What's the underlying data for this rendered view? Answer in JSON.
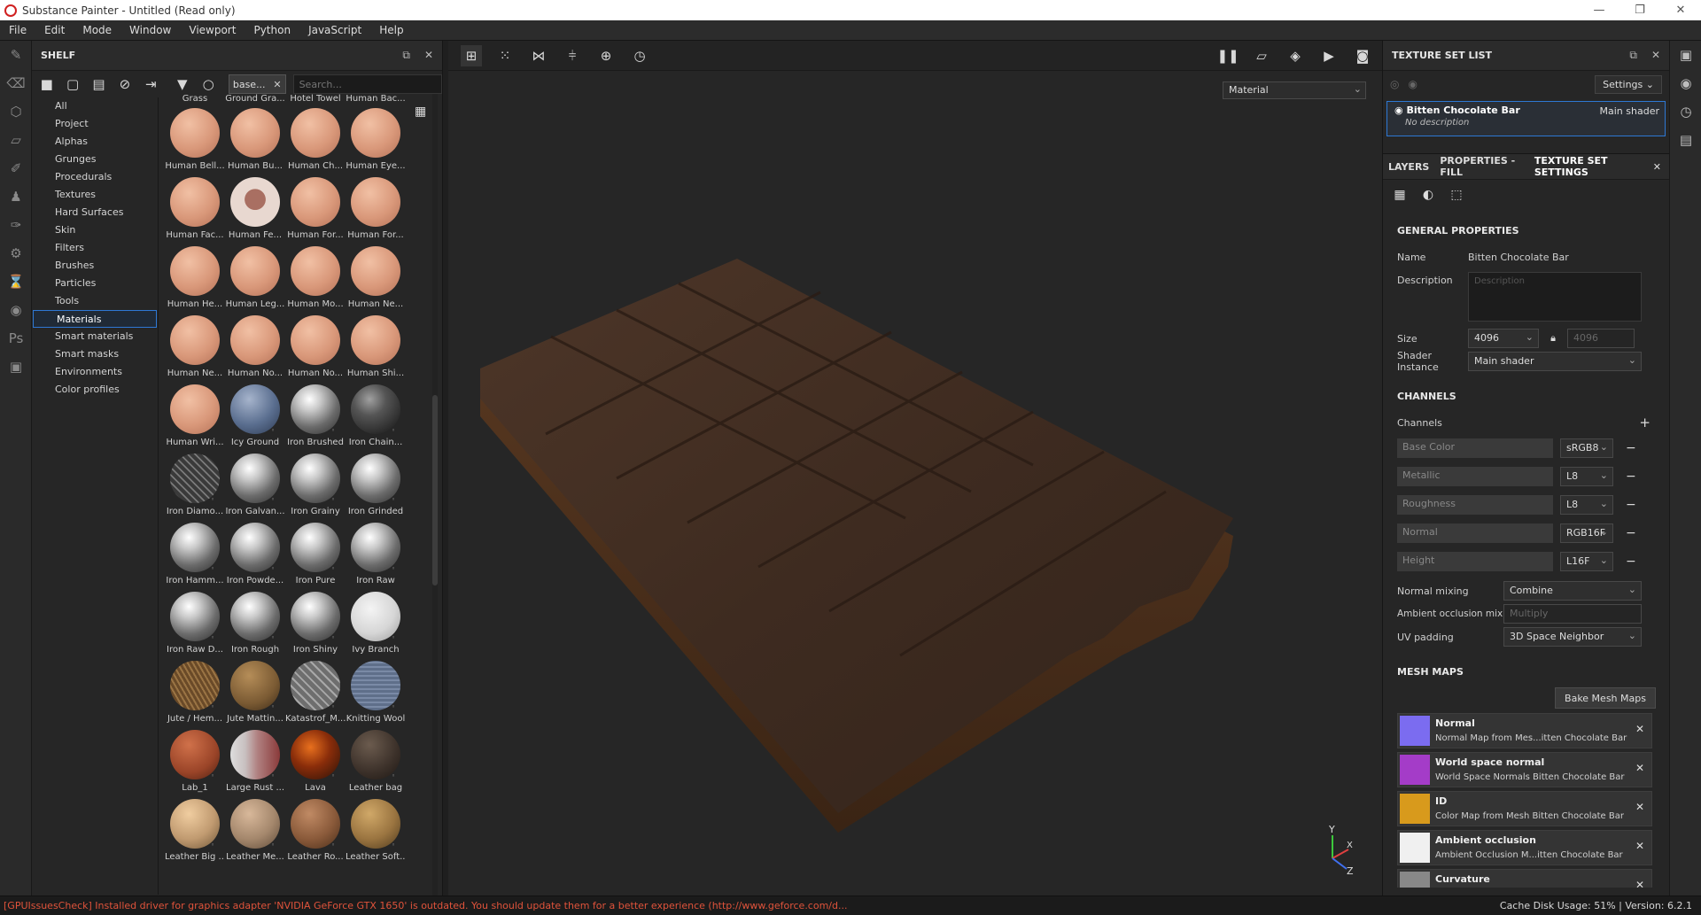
{
  "titlebar": {
    "title": "Substance Painter - Untitled (Read only)"
  },
  "menu": [
    "File",
    "Edit",
    "Mode",
    "Window",
    "Viewport",
    "Python",
    "JavaScript",
    "Help"
  ],
  "shelf": {
    "title": "SHELF",
    "filter_chip": "base...",
    "search_placeholder": "Search...",
    "categories": [
      "All",
      "Project",
      "Alphas",
      "Grunges",
      "Procedurals",
      "Textures",
      "Hard Surfaces",
      "Skin",
      "Filters",
      "Brushes",
      "Particles",
      "Tools",
      "Materials",
      "Smart materials",
      "Smart masks",
      "Environments",
      "Color profiles"
    ],
    "active_category": "Materials",
    "top_labels": [
      "Grass",
      "Ground Gra...",
      "Hotel Towel",
      "Human Bac..."
    ],
    "materials": [
      "Human Bell...",
      "Human Bu...",
      "Human Ch...",
      "Human Eye...",
      "Human Fac...",
      "Human Fe...",
      "Human For...",
      "Human For...",
      "Human He...",
      "Human Leg...",
      "Human Mo...",
      "Human Ne...",
      "Human Ne...",
      "Human No...",
      "Human No...",
      "Human Shi...",
      "Human Wri...",
      "Icy Ground",
      "Iron Brushed",
      "Iron Chain...",
      "Iron Diamo...",
      "Iron Galvan...",
      "Iron Grainy",
      "Iron Grinded",
      "Iron Hamm...",
      "Iron Powde...",
      "Iron Pure",
      "Iron Raw",
      "Iron Raw D...",
      "Iron Rough",
      "Iron Shiny",
      "Ivy Branch",
      "Jute / Hem...",
      "Jute Mattin...",
      "Katastrof_M...",
      "Knitting Wool",
      "Lab_1",
      "Large Rust ...",
      "Lava",
      "Leather bag",
      "Leather Big ...",
      "Leather Me...",
      "Leather Ro...",
      "Leather Soft..."
    ]
  },
  "viewport": {
    "material_select": "Material",
    "gizmo": {
      "y": "Y",
      "x": "X",
      "z": "Z"
    }
  },
  "texture_set_list": {
    "title": "TEXTURE SET LIST",
    "settings_label": "Settings",
    "item": {
      "name": "Bitten Chocolate Bar",
      "shader": "Main shader",
      "description": "No description"
    }
  },
  "tabs": {
    "layers": "LAYERS",
    "properties": "PROPERTIES - FILL",
    "tss": "TEXTURE SET SETTINGS"
  },
  "general": {
    "title": "GENERAL PROPERTIES",
    "name_label": "Name",
    "name_value": "Bitten Chocolate Bar",
    "description_label": "Description",
    "description_placeholder": "Description",
    "size_label": "Size",
    "size_value": "4096",
    "size_value2": "4096",
    "shader_label": "Shader Instance",
    "shader_value": "Main shader"
  },
  "channels": {
    "title": "CHANNELS",
    "label": "Channels",
    "list": [
      {
        "name": "Base Color",
        "format": "sRGB8"
      },
      {
        "name": "Metallic",
        "format": "L8"
      },
      {
        "name": "Roughness",
        "format": "L8"
      },
      {
        "name": "Normal",
        "format": "RGB16F"
      },
      {
        "name": "Height",
        "format": "L16F"
      }
    ],
    "normal_mixing_label": "Normal mixing",
    "normal_mixing_value": "Combine",
    "ao_mixing_label": "Ambient occlusion mixing",
    "ao_mixing_value": "Multiply",
    "uv_padding_label": "UV padding",
    "uv_padding_value": "3D Space Neighbor"
  },
  "mesh_maps": {
    "title": "MESH MAPS",
    "bake_label": "Bake Mesh Maps",
    "list": [
      {
        "name": "Normal",
        "desc": "Normal Map from Mes...itten Chocolate Bar",
        "color": "#7b6cf0"
      },
      {
        "name": "World space normal",
        "desc": "World Space Normals Bitten Chocolate Bar",
        "color": "#a43cc8"
      },
      {
        "name": "ID",
        "desc": "Color Map from Mesh Bitten Chocolate Bar",
        "color": "#d89a1c"
      },
      {
        "name": "Ambient occlusion",
        "desc": "Ambient Occlusion M...itten Chocolate Bar",
        "color": "#f0f0f0"
      },
      {
        "name": "Curvature",
        "desc": "",
        "color": "#888888"
      }
    ]
  },
  "status": {
    "error": "[GPUIssuesCheck] Installed driver for graphics adapter 'NVIDIA GeForce GTX 1650' is outdated. You should update them for a better experience (http://www.geforce.com/d...",
    "info": "Cache Disk Usage:    51% | Version: 6.2.1"
  }
}
